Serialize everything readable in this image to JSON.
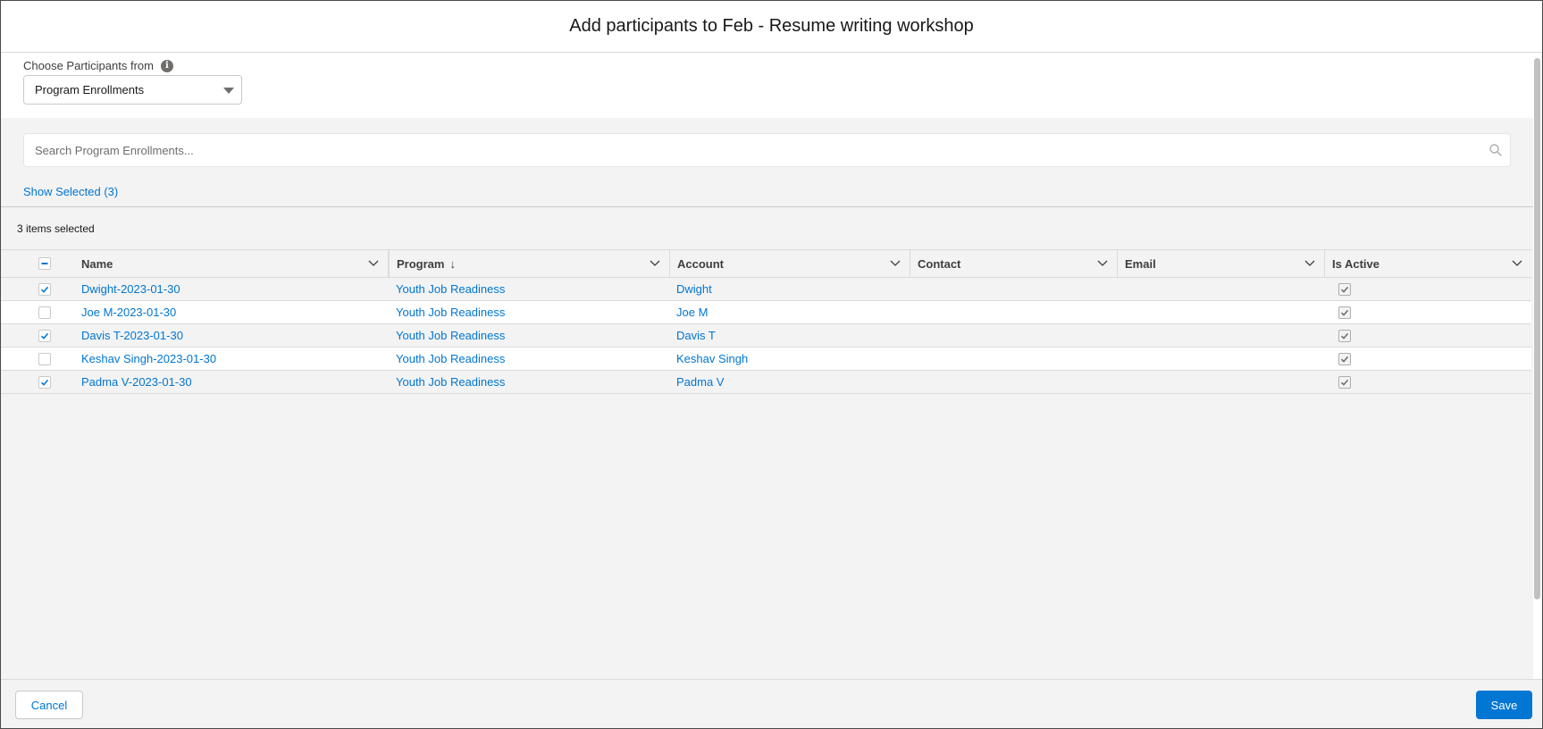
{
  "dialog": {
    "title": "Add participants to Feb - Resume writing workshop"
  },
  "source": {
    "label": "Choose Participants from",
    "info_icon": "info-icon",
    "selected": "Program Enrollments"
  },
  "search": {
    "placeholder": "Search Program Enrollments...",
    "value": ""
  },
  "show_selected_label": "Show Selected (3)",
  "selection_count": "3 items selected",
  "table": {
    "columns": [
      {
        "label": "Name"
      },
      {
        "label": "Program",
        "sort": "↓"
      },
      {
        "label": "Account"
      },
      {
        "label": "Contact"
      },
      {
        "label": "Email"
      },
      {
        "label": "Is Active"
      }
    ],
    "rows": [
      {
        "selected": true,
        "name": "Dwight-2023-01-30",
        "program": "Youth Job Readiness",
        "account": "Dwight",
        "contact": "",
        "email": "",
        "is_active": true
      },
      {
        "selected": false,
        "name": "Joe M-2023-01-30",
        "program": "Youth Job Readiness",
        "account": "Joe M",
        "contact": "",
        "email": "",
        "is_active": true
      },
      {
        "selected": true,
        "name": "Davis T-2023-01-30",
        "program": "Youth Job Readiness",
        "account": "Davis T",
        "contact": "",
        "email": "",
        "is_active": true
      },
      {
        "selected": false,
        "name": "Keshav Singh-2023-01-30",
        "program": "Youth Job Readiness",
        "account": "Keshav Singh",
        "contact": "",
        "email": "",
        "is_active": true
      },
      {
        "selected": true,
        "name": "Padma V-2023-01-30",
        "program": "Youth Job Readiness",
        "account": "Padma V",
        "contact": "",
        "email": "",
        "is_active": true
      }
    ]
  },
  "footer": {
    "cancel_label": "Cancel",
    "save_label": "Save"
  },
  "colors": {
    "link": "#0176d3",
    "brand": "#0176d3",
    "selected_row": "#f3f3f3"
  }
}
